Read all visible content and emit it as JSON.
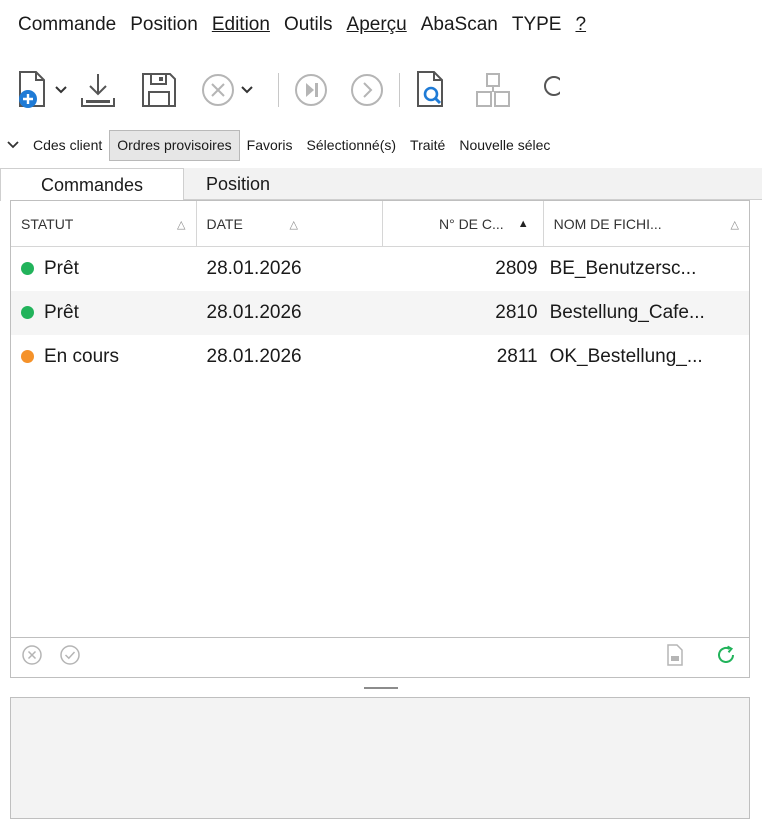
{
  "menu": {
    "items": [
      {
        "label": "Commande"
      },
      {
        "label": "Position"
      },
      {
        "label": "Edition"
      },
      {
        "label": "Outils"
      },
      {
        "label": "Aperçu"
      },
      {
        "label": "AbaScan"
      },
      {
        "label": "TYPE"
      },
      {
        "label": "?"
      }
    ]
  },
  "toolbar": {
    "icons": [
      "new-document-icon",
      "download-icon",
      "save-icon",
      "cancel-icon",
      "skip-icon",
      "next-icon",
      "preview-icon",
      "structure-icon",
      "search-icon"
    ],
    "accent": "#1f7bd6"
  },
  "filters": {
    "tabs": [
      {
        "label": "Cdes client"
      },
      {
        "label": "Ordres provisoires"
      },
      {
        "label": "Favoris"
      },
      {
        "label": "Sélectionné(s)"
      },
      {
        "label": "Traité"
      },
      {
        "label": "Nouvelle sélec"
      }
    ],
    "active": "Ordres provisoires"
  },
  "main_tabs": [
    {
      "label": "Commandes"
    },
    {
      "label": "Position"
    }
  ],
  "table": {
    "columns": [
      {
        "label": "STATUT"
      },
      {
        "label": "DATE"
      },
      {
        "label": "N° DE C..."
      },
      {
        "label": "NOM DE FICHI..."
      }
    ],
    "sorted_column": "N° DE C...",
    "rows": [
      {
        "status": "Prêt",
        "status_color": "#22b35b",
        "date": "28.01.2026",
        "number": "2809",
        "filename": "BE_Benutzersc..."
      },
      {
        "status": "Prêt",
        "status_color": "#22b35b",
        "date": "28.01.2026",
        "number": "2810",
        "filename": "Bestellung_Cafe..."
      },
      {
        "status": "En cours",
        "status_color": "#f5922a",
        "date": "28.01.2026",
        "number": "2811",
        "filename": "OK_Bestellung_..."
      }
    ]
  },
  "footer": {
    "icons": [
      "reject-icon",
      "approve-icon",
      "document-icon",
      "refresh-icon"
    ],
    "refresh_color": "#22b35b"
  }
}
